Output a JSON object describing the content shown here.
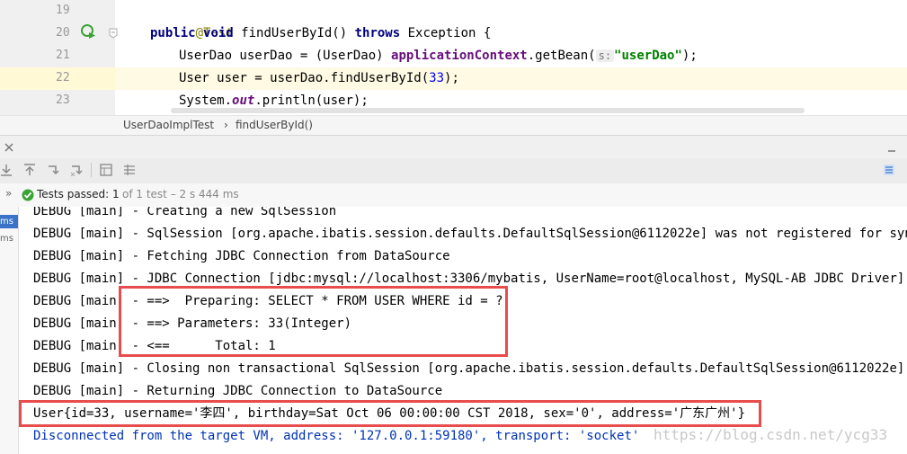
{
  "editor": {
    "line_numbers": [
      "19",
      "20",
      "21",
      "22",
      "23"
    ],
    "lines": {
      "l19": {
        "annotation": "@Test"
      },
      "l20": {
        "kw1": "public",
        "kw2": "void",
        "name": " findUserById() ",
        "kw3": "throws",
        "rest": " Exception {"
      },
      "l21": {
        "pre": "UserDao userDao = (UserDao) ",
        "obj": "applicationContext",
        "mid": ".getBean(",
        "hint": "s:",
        "str": "\"userDao\"",
        "end": ");"
      },
      "l22": {
        "pre": "User user = userDao.findUserById(",
        "num": "33",
        "end": ");"
      },
      "l23": {
        "pre": "System.",
        "fld": "out",
        "end": ".println(user);"
      }
    }
  },
  "breadcrumb": {
    "file": "UserDaoImplTest",
    "sep": "›",
    "method": "findUserById()"
  },
  "status": {
    "chevron": "»",
    "passed_label": "Tests passed: 1",
    "detail": "of 1 test – 2 s 444 ms"
  },
  "leftstrip": {
    "item1": "ms",
    "item2": "ms"
  },
  "console": {
    "lines": [
      "DEBUG [main] - Creating a new SqlSession",
      "DEBUG [main] - SqlSession [org.apache.ibatis.session.defaults.DefaultSqlSession@6112022e] was not registered for synchroni",
      "DEBUG [main] - Fetching JDBC Connection from DataSource",
      "DEBUG [main] - JDBC Connection [jdbc:mysql://localhost:3306/mybatis, UserName=root@localhost, MySQL-AB JDBC Driver] will n",
      "DEBUG [main] - ==>  Preparing: SELECT * FROM USER WHERE id = ?",
      "DEBUG [main] - ==> Parameters: 33(Integer)",
      "DEBUG [main] - <==      Total: 1",
      "DEBUG [main] - Closing non transactional SqlSession [org.apache.ibatis.session.defaults.DefaultSqlSession@6112022e]",
      "DEBUG [main] - Returning JDBC Connection to DataSource",
      "User{id=33, username='李四', birthday=Sat Oct 06 00:00:00 CST 2018, sex='0', address='广东广州'}",
      "Disconnected from the target VM, address: '127.0.0.1:59180', transport: 'socket'"
    ],
    "watermark": "https://blog.csdn.net/ycg33"
  },
  "colors": {
    "highlight_box": "#e84c4c",
    "pass_green": "#3aa335",
    "keyword": "#000080",
    "string": "#008000"
  }
}
